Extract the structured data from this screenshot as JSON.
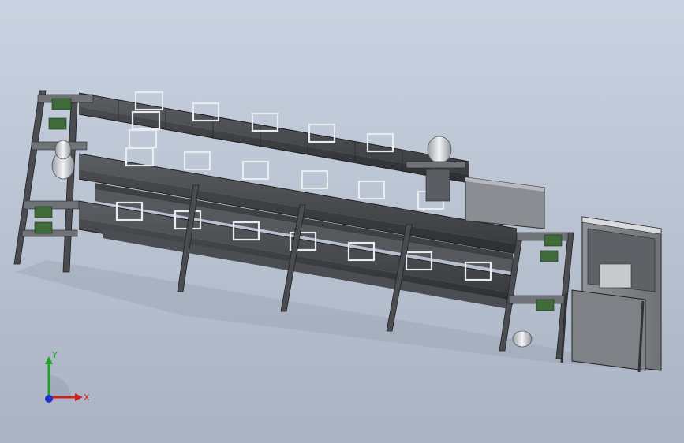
{
  "viewport": {
    "background_top": "#c9d2e0",
    "background_bottom": "#aab3c3"
  },
  "triad": {
    "x_label": "X",
    "y_label": "Y",
    "x_color": "#d02020",
    "y_color": "#1fa21f",
    "z_color": "#1f2fd0"
  }
}
